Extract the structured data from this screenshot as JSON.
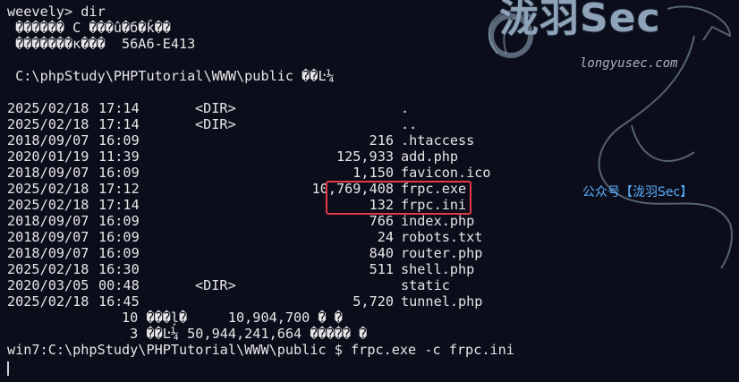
{
  "terminal": {
    "prompt_line": "weevely> dir",
    "volume_line": " ������ C ���û�б�ǩ��",
    "serial_line": " �������к���  56A6-E413",
    "dir_line": " C:\\phpStudy\\PHPTutorial\\WWW\\public ��Ŀ¼",
    "entries": [
      {
        "date": "2025/02/18",
        "time": "17:14",
        "type": "<DIR>",
        "size": "",
        "name": "."
      },
      {
        "date": "2025/02/18",
        "time": "17:14",
        "type": "<DIR>",
        "size": "",
        "name": ".."
      },
      {
        "date": "2018/09/07",
        "time": "16:09",
        "type": "",
        "size": "216",
        "name": ".htaccess"
      },
      {
        "date": "2020/01/19",
        "time": "11:39",
        "type": "",
        "size": "125,933",
        "name": "add.php"
      },
      {
        "date": "2018/09/07",
        "time": "16:09",
        "type": "",
        "size": "1,150",
        "name": "favicon.ico"
      },
      {
        "date": "2025/02/18",
        "time": "17:12",
        "type": "",
        "size": "10,769,408",
        "name": "frpc.exe"
      },
      {
        "date": "2025/02/18",
        "time": "17:14",
        "type": "",
        "size": "132",
        "name": "frpc.ini"
      },
      {
        "date": "2018/09/07",
        "time": "16:09",
        "type": "",
        "size": "766",
        "name": "index.php"
      },
      {
        "date": "2018/09/07",
        "time": "16:09",
        "type": "",
        "size": "24",
        "name": "robots.txt"
      },
      {
        "date": "2018/09/07",
        "time": "16:09",
        "type": "",
        "size": "840",
        "name": "router.php"
      },
      {
        "date": "2025/02/18",
        "time": "16:30",
        "type": "",
        "size": "511",
        "name": "shell.php"
      },
      {
        "date": "2020/03/05",
        "time": "00:48",
        "type": "<DIR>",
        "size": "",
        "name": "static"
      },
      {
        "date": "2025/02/18",
        "time": "16:45",
        "type": "",
        "size": "5,720",
        "name": "tunnel.php"
      }
    ],
    "summary_files": "              10 ���ļ�     10,904,700 � �",
    "summary_dirs": "               3 ��Ŀ¼ 50,944,241,664 ����� �",
    "command_line": "win7:C:\\phpStudy\\PHPTutorial\\WWW\\public $ frpc.exe -c frpc.ini"
  },
  "watermark": {
    "logo": "泷羽Sec",
    "url": "longyusec.com",
    "wechat": "公众号【泷羽Sec】"
  },
  "colors": {
    "background": "#0b0d1a",
    "text": "#e6e6e6",
    "highlight_box": "#e23b46",
    "wechat_text": "#5ab0ff"
  }
}
